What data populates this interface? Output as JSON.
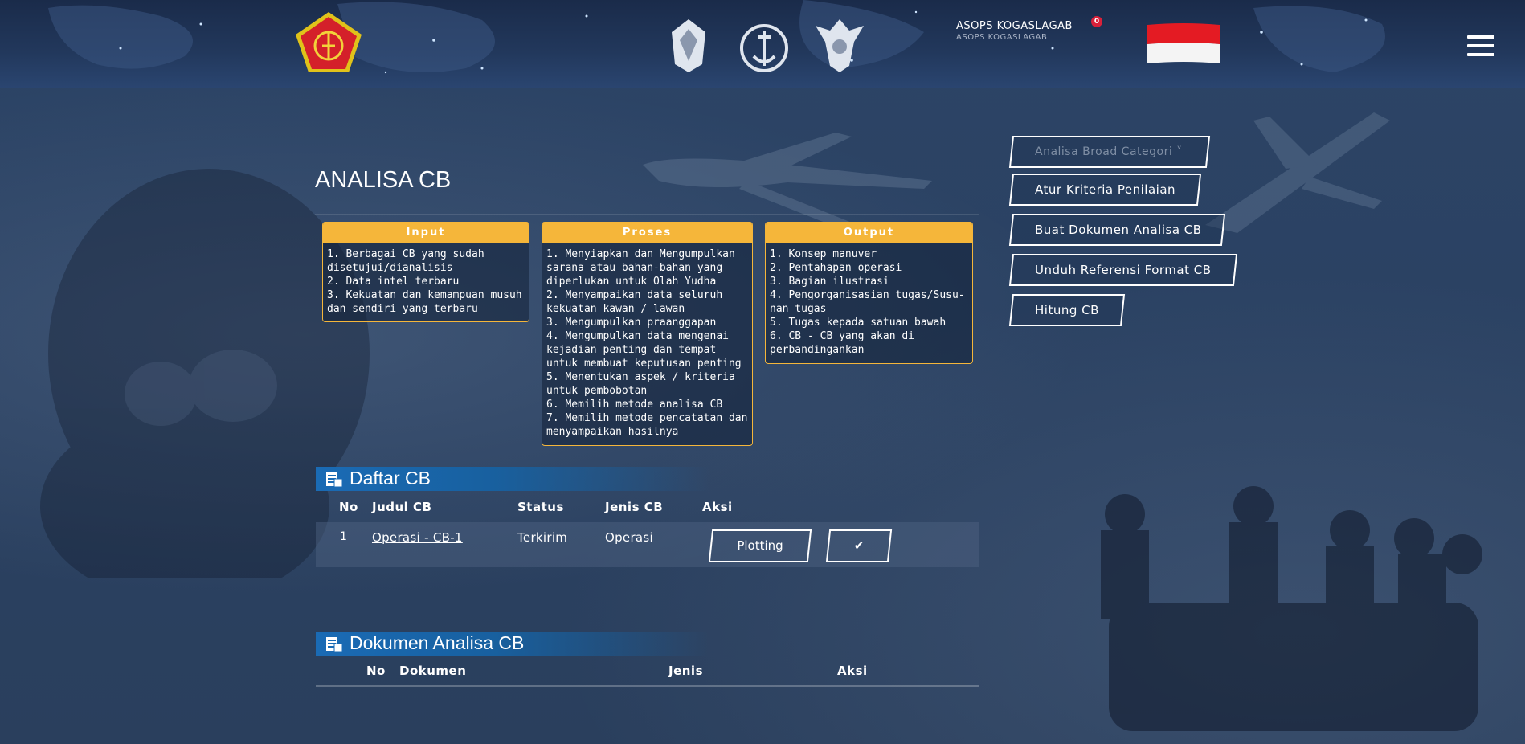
{
  "header": {
    "user_name": "ASOPS KOGASLAGAB",
    "user_sub": "ASOPS KOGASLAGAB",
    "notif_count": "0"
  },
  "page": {
    "title": "ANALISA CB"
  },
  "cards": [
    {
      "title": "Input",
      "items": [
        "1. Berbagai CB yang sudah disetujui/dianalisis",
        "2. Data intel terbaru",
        "3. Kekuatan dan kemampuan musuh dan sendiri yang terbaru"
      ]
    },
    {
      "title": "Proses",
      "items": [
        "1. Menyiapkan dan Mengumpulkan sarana atau bahan-bahan yang diperlukan untuk Olah Yudha",
        "2. Menyampaikan data seluruh kekuatan kawan / lawan",
        "3. Mengumpulkan praanggapan",
        "4. Mengumpulkan data mengenai kejadian penting dan tempat untuk membuat keputusan penting",
        "5. Menentukan aspek / kriteria untuk pembobotan",
        "6. Memilih metode analisa CB",
        "7. Memilih metode pencatatan dan menyampaikan hasilnya"
      ]
    },
    {
      "title": "Output",
      "items": [
        "1. Konsep manuver",
        "2. Pentahapan operasi",
        "3. Bagian ilustrasi",
        "4. Pengorganisasian tugas/Susu-nan tugas",
        "5. Tugas kepada satuan bawah",
        "6. CB - CB yang akan di perbandingankan"
      ]
    }
  ],
  "side_buttons": {
    "dropdown": "Analisa Broad Categori ˅",
    "atur": "Atur Kriteria Penilaian",
    "buat": "Buat Dokumen Analisa CB",
    "unduh": "Unduh Referensi Format CB",
    "hitung": "Hitung CB"
  },
  "daftar": {
    "title": "Daftar CB",
    "columns": [
      "No",
      "Judul CB",
      "Status",
      "Jenis CB",
      "Aksi"
    ],
    "rows": [
      {
        "no": "1",
        "judul": "Operasi - CB-1",
        "status": "Terkirim",
        "jenis": "Operasi",
        "action_plot": "Plotting",
        "action_check": "✔"
      }
    ]
  },
  "dokumen": {
    "title": "Dokumen Analisa CB",
    "columns": [
      "No",
      "Dokumen",
      "Jenis",
      "Aksi"
    ]
  },
  "colors": {
    "accent": "#f5b63a",
    "section_blue": "#1a6bb5",
    "badge": "#d9213a"
  }
}
